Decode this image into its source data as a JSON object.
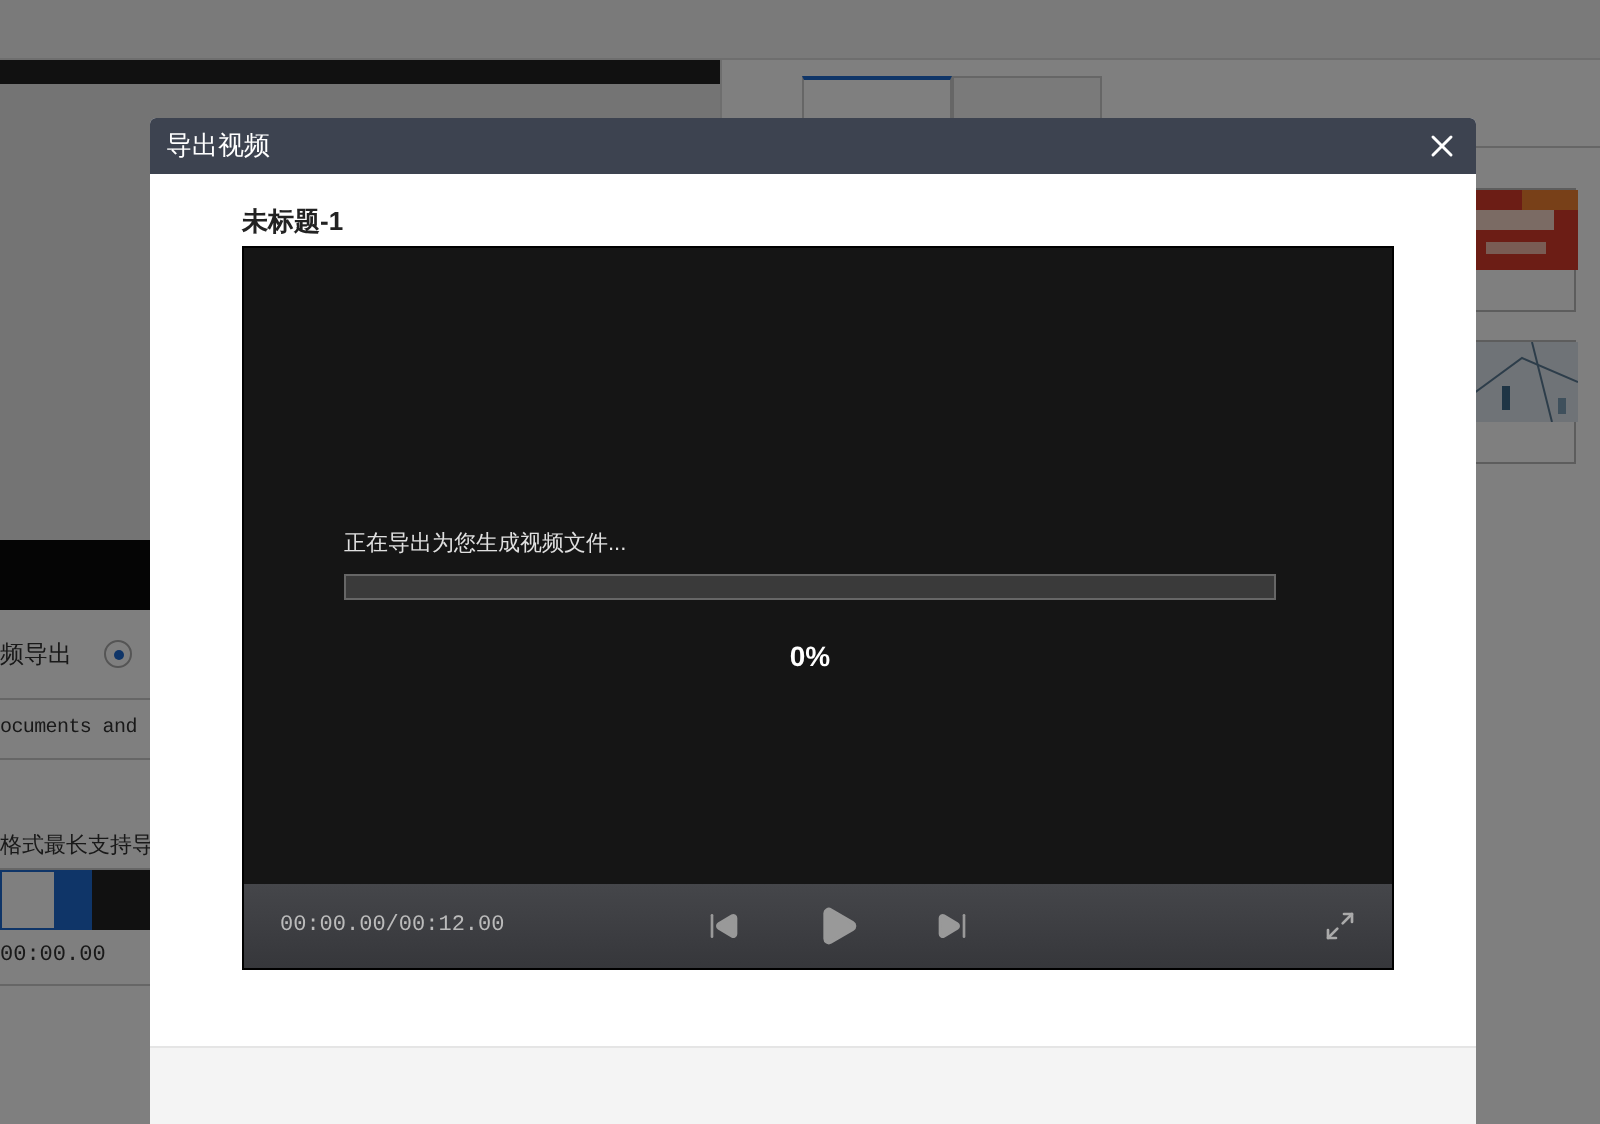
{
  "background": {
    "tabs": [
      {
        "selected": true
      },
      {
        "selected": false
      }
    ],
    "export_option": {
      "label": "频导出",
      "selected": true
    },
    "path": "ocuments and",
    "hint": "格式最长支持导",
    "time": "00:00.00"
  },
  "dialog": {
    "title": "导出视频",
    "file_name": "未标题-1",
    "progress": {
      "message": "正在导出为您生成视频文件...",
      "level": 0,
      "percent": "0%"
    },
    "player": {
      "time": "00:00.00/00:12.00"
    }
  }
}
